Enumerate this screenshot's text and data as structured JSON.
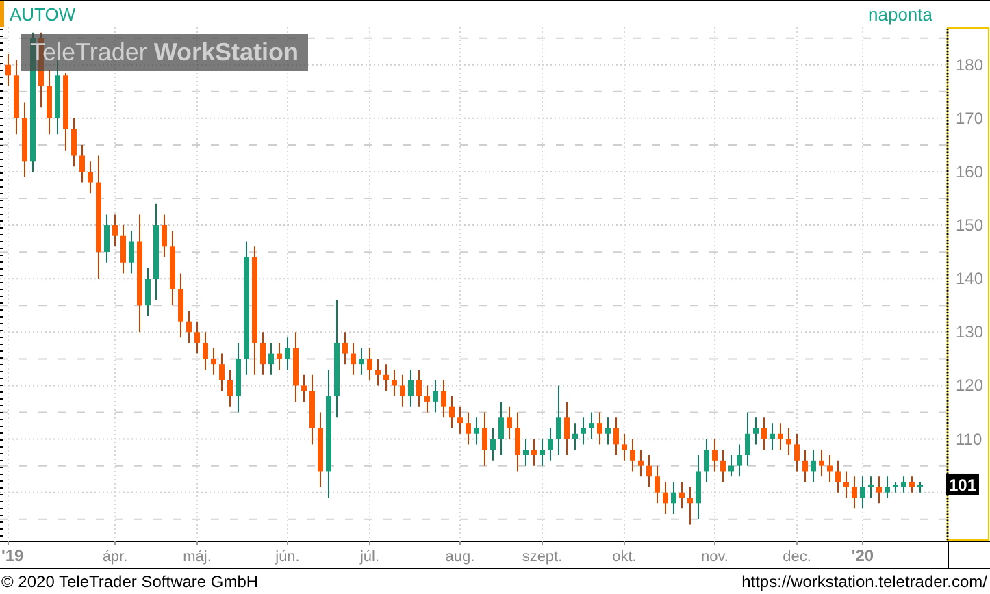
{
  "header": {
    "symbol": "AUTOW",
    "interval": "naponta"
  },
  "logo": "TeleTrader **WorkStation**",
  "chart": {
    "last_price": "101",
    "chart_data": {
      "type": "candlestick",
      "grid": true,
      "ylim": [
        91,
        187
      ],
      "yticks": [
        110,
        120,
        130,
        140,
        150,
        160,
        170,
        180
      ],
      "categories": [
        "'19",
        null,
        null,
        null,
        null,
        null,
        null,
        null,
        null,
        null,
        null,
        null,
        null,
        "ápr.",
        null,
        null,
        null,
        null,
        null,
        null,
        null,
        null,
        null,
        "máj.",
        null,
        null,
        null,
        null,
        null,
        null,
        null,
        null,
        null,
        null,
        "jún.",
        null,
        null,
        null,
        null,
        null,
        null,
        null,
        null,
        null,
        "júl.",
        null,
        null,
        null,
        null,
        null,
        null,
        null,
        null,
        null,
        null,
        "aug.",
        null,
        null,
        null,
        null,
        null,
        null,
        null,
        null,
        null,
        "szept.",
        null,
        null,
        null,
        null,
        null,
        null,
        null,
        null,
        null,
        "okt.",
        null,
        null,
        null,
        null,
        null,
        null,
        null,
        null,
        null,
        null,
        "nov.",
        null,
        null,
        null,
        null,
        null,
        null,
        null,
        null,
        null,
        "dec.",
        null,
        null,
        null,
        null,
        null,
        null,
        null,
        "'20",
        null,
        null,
        null,
        null,
        null,
        null,
        null
      ],
      "ohlc": [
        [
          180,
          182,
          176,
          178
        ],
        [
          178,
          181,
          167,
          170
        ],
        [
          170,
          173,
          159,
          162
        ],
        [
          162,
          186,
          160,
          185
        ],
        [
          185,
          186,
          172,
          176
        ],
        [
          176,
          179,
          167,
          170
        ],
        [
          170,
          181,
          167,
          178
        ],
        [
          178,
          178.5,
          164,
          168
        ],
        [
          168,
          170,
          161,
          163
        ],
        [
          163,
          165,
          158,
          160
        ],
        [
          160,
          162,
          156,
          158
        ],
        [
          158,
          163,
          140,
          145
        ],
        [
          145,
          152,
          143,
          150
        ],
        [
          150,
          152,
          146,
          148
        ],
        [
          148,
          150,
          141,
          143
        ],
        [
          143,
          149,
          141,
          147
        ],
        [
          147,
          152,
          130,
          135
        ],
        [
          135,
          142,
          133,
          140
        ],
        [
          140,
          154,
          136,
          150
        ],
        [
          150,
          152,
          144,
          146
        ],
        [
          146,
          149,
          135,
          138
        ],
        [
          138,
          141,
          129,
          132
        ],
        [
          132,
          134,
          128,
          130
        ],
        [
          130,
          132,
          126,
          128
        ],
        [
          128,
          130,
          123,
          125
        ],
        [
          125,
          127,
          122,
          124
        ],
        [
          124,
          126,
          119,
          121
        ],
        [
          121,
          123,
          116,
          118
        ],
        [
          118,
          128,
          115,
          125
        ],
        [
          125,
          147,
          122,
          144
        ],
        [
          144,
          146,
          122,
          128
        ],
        [
          128,
          130,
          122,
          124
        ],
        [
          124,
          128,
          122,
          126
        ],
        [
          126,
          128,
          123,
          125
        ],
        [
          125,
          129,
          123,
          127
        ],
        [
          127,
          130,
          117,
          120
        ],
        [
          120,
          122,
          117,
          119
        ],
        [
          119,
          122,
          109,
          112
        ],
        [
          112,
          115,
          101,
          104
        ],
        [
          104,
          123,
          99,
          118
        ],
        [
          118,
          136,
          114,
          128
        ],
        [
          128,
          130,
          124,
          126
        ],
        [
          126,
          128,
          122,
          124
        ],
        [
          124,
          127,
          122,
          125
        ],
        [
          125,
          127,
          121,
          123
        ],
        [
          123,
          125,
          120,
          122
        ],
        [
          122,
          124,
          119,
          121
        ],
        [
          121,
          123,
          118,
          120
        ],
        [
          120,
          122,
          116,
          118
        ],
        [
          118,
          123,
          116,
          121
        ],
        [
          121,
          123,
          116,
          118
        ],
        [
          118,
          120,
          115,
          117
        ],
        [
          117,
          121,
          115,
          119
        ],
        [
          119,
          121,
          114,
          116
        ],
        [
          116,
          118,
          112,
          114
        ],
        [
          114,
          116,
          111,
          113
        ],
        [
          113,
          115,
          109,
          111
        ],
        [
          111,
          114,
          109,
          112
        ],
        [
          112,
          115,
          105,
          108
        ],
        [
          108,
          112,
          106,
          110
        ],
        [
          110,
          117,
          107,
          114
        ],
        [
          114,
          116,
          110,
          112
        ],
        [
          112,
          115,
          104,
          107
        ],
        [
          107,
          110,
          105,
          108
        ],
        [
          108,
          110,
          105,
          107
        ],
        [
          107,
          110,
          105,
          108
        ],
        [
          108,
          112,
          106,
          110
        ],
        [
          110,
          120,
          107,
          114
        ],
        [
          114,
          117,
          107,
          110
        ],
        [
          110,
          113,
          108,
          111
        ],
        [
          111,
          114,
          109,
          112
        ],
        [
          112,
          115,
          110,
          113
        ],
        [
          113,
          115,
          109,
          111
        ],
        [
          111,
          114,
          109,
          112
        ],
        [
          112,
          114,
          107,
          109
        ],
        [
          109,
          111,
          106,
          108
        ],
        [
          108,
          110,
          104,
          106
        ],
        [
          106,
          108,
          103,
          105
        ],
        [
          105,
          107,
          101,
          103
        ],
        [
          103,
          105,
          98,
          100
        ],
        [
          100,
          102,
          96,
          98
        ],
        [
          98,
          102,
          96,
          100
        ],
        [
          100,
          102,
          97,
          99
        ],
        [
          99,
          101,
          94,
          98
        ],
        [
          98,
          107,
          95,
          104
        ],
        [
          104,
          110,
          102,
          108
        ],
        [
          108,
          110,
          104,
          106
        ],
        [
          106,
          108,
          102,
          104
        ],
        [
          104,
          107,
          103,
          105
        ],
        [
          105,
          109,
          103,
          107
        ],
        [
          107,
          115,
          105,
          111
        ],
        [
          111,
          114,
          109,
          112
        ],
        [
          112,
          114,
          108,
          110
        ],
        [
          110,
          113,
          108,
          111
        ],
        [
          111,
          113,
          108,
          110
        ],
        [
          110,
          112,
          107,
          109
        ],
        [
          109,
          111,
          104,
          106
        ],
        [
          106,
          108,
          102,
          104
        ],
        [
          104,
          108,
          102,
          106
        ],
        [
          106,
          108,
          103,
          105
        ],
        [
          105,
          107,
          102,
          104
        ],
        [
          104,
          106,
          100,
          102
        ],
        [
          102,
          104,
          99,
          101
        ],
        [
          101,
          103,
          97,
          99
        ],
        [
          99,
          103,
          97,
          101
        ],
        [
          101,
          103,
          99,
          101.5
        ],
        [
          101,
          103,
          98,
          100
        ],
        [
          100,
          103,
          99,
          101
        ],
        [
          101,
          102,
          100,
          101.5
        ],
        [
          101,
          103,
          100,
          102
        ],
        [
          102,
          103,
          100,
          101
        ],
        [
          101,
          102,
          100,
          101.5
        ]
      ]
    }
  },
  "footer": {
    "copyright": "© 2020 TeleTrader Software GmbH",
    "url": "https://workstation.teletrader.com/"
  }
}
